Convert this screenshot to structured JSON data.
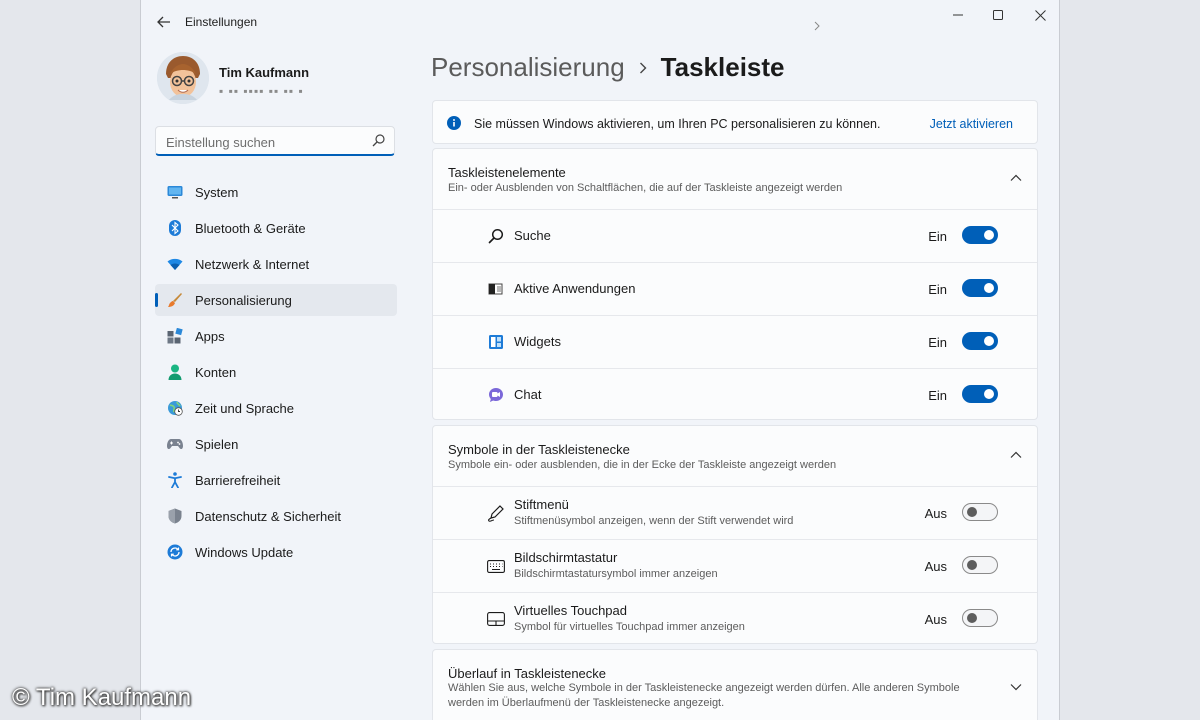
{
  "window": {
    "title": "Einstellungen"
  },
  "user": {
    "name": "Tim Kaufmann",
    "email_masked": "▪ ▪▪ ▪▪▪▪ ▪▪ ▪▪ ▪"
  },
  "search": {
    "placeholder": "Einstellung suchen"
  },
  "nav": [
    {
      "label": "System",
      "icon": "monitor-icon",
      "active": false
    },
    {
      "label": "Bluetooth & Geräte",
      "icon": "bluetooth-icon",
      "active": false
    },
    {
      "label": "Netzwerk & Internet",
      "icon": "wifi-icon",
      "active": false
    },
    {
      "label": "Personalisierung",
      "icon": "brush-icon",
      "active": true
    },
    {
      "label": "Apps",
      "icon": "apps-icon",
      "active": false
    },
    {
      "label": "Konten",
      "icon": "person-icon",
      "active": false
    },
    {
      "label": "Zeit und Sprache",
      "icon": "globe-clock-icon",
      "active": false
    },
    {
      "label": "Spielen",
      "icon": "gamepad-icon",
      "active": false
    },
    {
      "label": "Barrierefreiheit",
      "icon": "accessibility-icon",
      "active": false
    },
    {
      "label": "Datenschutz & Sicherheit",
      "icon": "shield-icon",
      "active": false
    },
    {
      "label": "Windows Update",
      "icon": "update-icon",
      "active": false
    }
  ],
  "breadcrumb": {
    "parent": "Personalisierung",
    "current": "Taskleiste"
  },
  "banner": {
    "text": "Sie müssen Windows aktivieren, um Ihren PC personalisieren zu können.",
    "link": "Jetzt aktivieren"
  },
  "taskbar_items": {
    "title": "Taskleistenelemente",
    "subtitle": "Ein- oder Ausblenden von Schaltflächen, die auf der Taskleiste angezeigt werden",
    "items": [
      {
        "label": "Suche",
        "state": "Ein",
        "on": true,
        "icon": "search-icon"
      },
      {
        "label": "Aktive Anwendungen",
        "state": "Ein",
        "on": true,
        "icon": "task-view-icon"
      },
      {
        "label": "Widgets",
        "state": "Ein",
        "on": true,
        "icon": "widgets-icon"
      },
      {
        "label": "Chat",
        "state": "Ein",
        "on": true,
        "icon": "chat-icon"
      }
    ]
  },
  "corner_icons": {
    "title": "Symbole in der Taskleistenecke",
    "subtitle": "Symbole ein- oder ausblenden, die in der Ecke der Taskleiste angezeigt werden",
    "items": [
      {
        "label": "Stiftmenü",
        "sub": "Stiftmenüsymbol anzeigen, wenn der Stift verwendet wird",
        "state": "Aus",
        "on": false,
        "icon": "pen-icon"
      },
      {
        "label": "Bildschirmtastatur",
        "sub": "Bildschirmtastatursymbol immer anzeigen",
        "state": "Aus",
        "on": false,
        "icon": "keyboard-icon"
      },
      {
        "label": "Virtuelles Touchpad",
        "sub": "Symbol für virtuelles Touchpad immer anzeigen",
        "state": "Aus",
        "on": false,
        "icon": "touchpad-icon"
      }
    ]
  },
  "overflow": {
    "title": "Überlauf in Taskleistenecke",
    "subtitle": "Wählen Sie aus, welche Symbole in der Taskleistenecke angezeigt werden dürfen. Alle anderen Symbole werden im Überlaufmenü der Taskleistenecke angezeigt."
  },
  "watermark": "© Tim Kaufmann",
  "colors": {
    "accent": "#005fb8",
    "window_bg": "#f1f4f9",
    "card_bg": "#fbfcfd"
  }
}
